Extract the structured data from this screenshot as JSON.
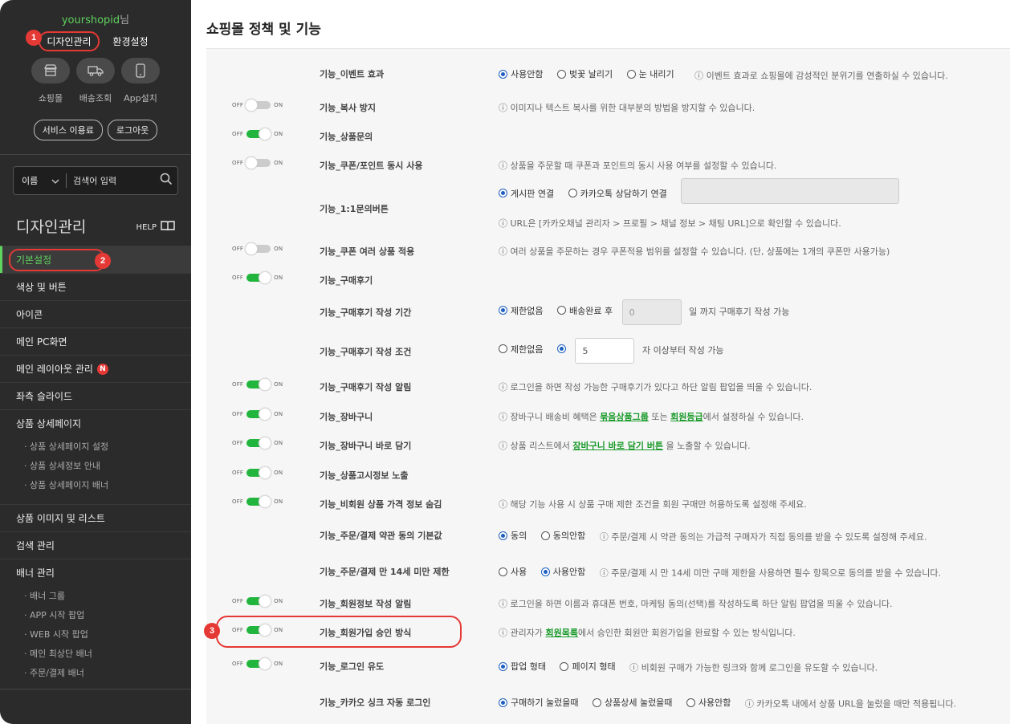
{
  "sidebar": {
    "user_id": "yourshopid",
    "user_suffix": "님",
    "links": [
      "디자인관리",
      "환경설정"
    ],
    "quick": [
      {
        "icon": "store-icon",
        "label": "쇼핑몰"
      },
      {
        "icon": "truck-icon",
        "label": "배송조회"
      },
      {
        "icon": "phone-icon",
        "label": "App설치"
      }
    ],
    "pills": [
      "서비스 이용료",
      "로그아웃"
    ],
    "search": {
      "select": "이름",
      "placeholder": "검색어 입력"
    },
    "title": "디자인관리",
    "help": "HELP",
    "menu": [
      "기본설정",
      "색상 및 버튼",
      "아이콘",
      "메인 PC화면",
      "메인 레이아웃 관리",
      "좌측 슬라이드",
      "상품 상세페이지"
    ],
    "badge_n": "N",
    "sub1": [
      "· 상품 상세페이지 설정",
      "· 상품 상세정보 안내",
      "· 상품 상세페이지 배너"
    ],
    "menu2": [
      "상품 이미지 및 리스트",
      "검색 관리",
      "배너 관리"
    ],
    "sub2": [
      "· 배너 그룹",
      "· APP 시작 팝업",
      "· WEB 시작 팝업",
      "· 메인 최상단 배너",
      "· 주문/결제 배너"
    ]
  },
  "annotations": [
    "1",
    "2",
    "3"
  ],
  "main": {
    "title": "쇼핑몰 정책 및 기능",
    "off": "OFF",
    "on": "ON",
    "rows": {
      "event": {
        "label": "기능_이벤트 효과",
        "opts": [
          "사용안함",
          "벚꽃 날리기",
          "눈 내리기"
        ],
        "info": "ⓘ 이벤트 효과로 쇼핑몰에 감성적인 분위기를 연출하실 수 있습니다."
      },
      "copy": {
        "label": "기능_복사 방지",
        "info": "ⓘ 이미지나 텍스트 복사를 위한 대부분의 방법을 방지할 수 있습니다."
      },
      "inquiry": {
        "label": "기능_상품문의"
      },
      "coupon_point": {
        "label": "기능_쿠폰/포인트 동시 사용",
        "info": "ⓘ 상품을 주문할 때 쿠폰과 포인트의 동시 사용 여부를 설정할 수 있습니다."
      },
      "one2one": {
        "label": "기능_1:1문의버튼",
        "opts": [
          "게시판 연결",
          "카카오톡 상담하기 연결"
        ],
        "info": "ⓘ URL은 [카카오채널 관리자 > 프로필 > 채널 정보 > 채팅 URL]으로 확인할 수 있습니다."
      },
      "coupon_multi": {
        "label": "기능_쿠폰 여러 상품 적용",
        "info": "ⓘ 여러 상품을 주문하는 경우 쿠폰적용 범위를 설정할 수 있습니다. (단, 상품에는 1개의 쿠폰만 사용가능)"
      },
      "review": {
        "label": "기능_구매후기"
      },
      "review_period": {
        "label": "기능_구매후기 작성 기간",
        "opts": [
          "제한없음",
          "배송완료 후"
        ],
        "value": "0",
        "suffix": "일 까지 구매후기 작성 가능"
      },
      "review_cond": {
        "label": "기능_구매후기 작성 조건",
        "opts": [
          "제한없음"
        ],
        "value": "5",
        "suffix": "자 이상부터 작성 가능"
      },
      "review_alert": {
        "label": "기능_구매후기 작성 알림",
        "info": "ⓘ 로그인을 하면 작성 가능한 구매후기가 있다고 하단 알림 팝업을 띄울 수 있습니다."
      },
      "cart": {
        "label": "기능_장바구니",
        "info_pre": "ⓘ 장바구니 배송비 혜택은 ",
        "link1": "묶음상품그룹",
        "info_mid": " 또는 ",
        "link2": "회원등급",
        "info_post": "에서 설정하실 수 있습니다."
      },
      "cart_direct": {
        "label": "기능_장바구니 바로 담기",
        "info_pre": "ⓘ 상품 리스트에서 ",
        "link": "장바구니 바로 담기 버튼",
        "info_post": " 을 노출할 수 있습니다."
      },
      "notice": {
        "label": "기능_상품고시정보 노출"
      },
      "hide_price": {
        "label": "기능_비회원 상품 가격 정보 숨김",
        "info": "ⓘ 해당 기능 사용 시 상품 구매 제한 조건을 회원 구매만 허용하도록 설정해 주세요."
      },
      "terms": {
        "label": "기능_주문/결제 약관 동의 기본값",
        "opts": [
          "동의",
          "동의안함"
        ],
        "info": "ⓘ 주문/결제 시 약관 동의는 가급적 구매자가 직접 동의를 받을 수 있도록 설정해 주세요."
      },
      "age14": {
        "label": "기능_주문/결제 만 14세 미만 제한",
        "opts": [
          "사용",
          "사용안함"
        ],
        "info": "ⓘ 주문/결제 시 만 14세 미만 구매 제한을 사용하면 필수 항목으로 동의를 받을 수 있습니다."
      },
      "member_info": {
        "label": "기능_회원정보 작성 알림",
        "info": "ⓘ 로그인을 하면 이름과 휴대폰 번호, 마케팅 동의(선택)를 작성하도록 하단 알림 팝업을 띄울 수 있습니다."
      },
      "join_approve": {
        "label": "기능_회원가입 승인 방식",
        "info_pre": "ⓘ 관리자가 ",
        "link": "회원목록",
        "info_post": "에서 승인한 회원만 회원가입을 완료할 수 있는 방식입니다."
      },
      "login_guide": {
        "label": "기능_로그인 유도",
        "opts": [
          "팝업 형태",
          "페이지 형태"
        ],
        "info": "ⓘ 비회원 구매가 가능한 링크와 함께 로그인을 유도할 수 있습니다."
      },
      "kakao": {
        "label": "기능_카카오 싱크 자동 로그인",
        "opts": [
          "구매하기 눌렀을때",
          "상품상세 눌렀을때",
          "사용안함"
        ],
        "info": "ⓘ 카카오톡 내에서 상품 URL을 눌렀을 때만 적용됩니다."
      }
    }
  }
}
